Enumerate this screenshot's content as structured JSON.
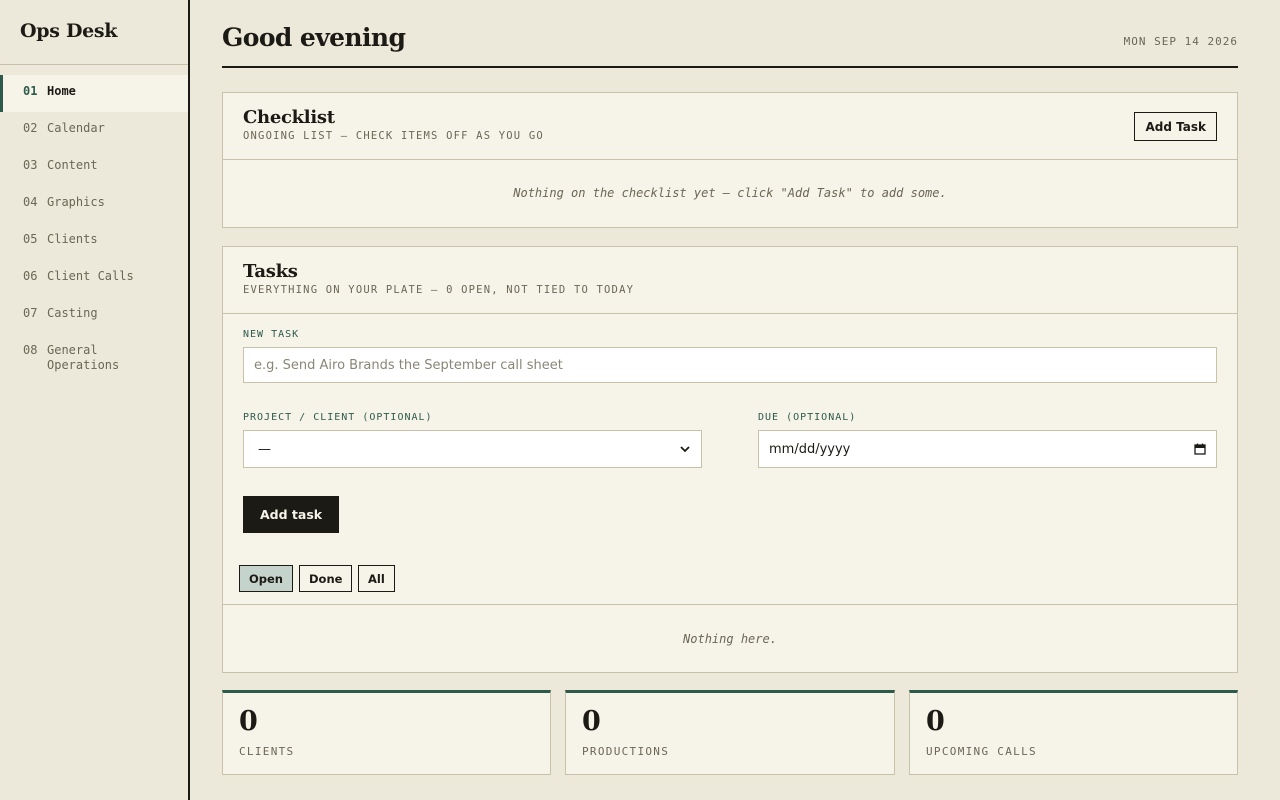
{
  "app": {
    "brand": "Ops Desk"
  },
  "sidebar": {
    "items": [
      {
        "num": "01",
        "label": "Home",
        "active": true
      },
      {
        "num": "02",
        "label": "Calendar"
      },
      {
        "num": "03",
        "label": "Content"
      },
      {
        "num": "04",
        "label": "Graphics"
      },
      {
        "num": "05",
        "label": "Clients"
      },
      {
        "num": "06",
        "label": "Client Calls"
      },
      {
        "num": "07",
        "label": "Casting"
      },
      {
        "num": "08",
        "label": "General Operations"
      }
    ]
  },
  "header": {
    "greeting": "Good evening",
    "date": "MON SEP 14 2026"
  },
  "checklist": {
    "title": "Checklist",
    "subtitle": "ONGOING LIST — CHECK ITEMS OFF AS YOU GO",
    "add_button": "Add Task",
    "empty_text": "Nothing on the checklist yet — click \"Add Task\" to add some."
  },
  "tasks": {
    "title": "Tasks",
    "subtitle": "EVERYTHING ON YOUR PLATE — 0 OPEN, NOT TIED TO TODAY",
    "new_task_label": "NEW TASK",
    "new_task_placeholder": "e.g. Send Airo Brands the September call sheet",
    "project_label": "PROJECT / CLIENT (OPTIONAL)",
    "project_value": "—",
    "due_label": "DUE (OPTIONAL)",
    "due_value": "mm/dd/yyyy",
    "add_button": "Add task",
    "filters": [
      {
        "label": "Open",
        "active": true
      },
      {
        "label": "Done"
      },
      {
        "label": "All"
      }
    ],
    "empty_text": "Nothing here."
  },
  "stats": [
    {
      "value": "0",
      "label": "CLIENTS"
    },
    {
      "value": "0",
      "label": "PRODUCTIONS"
    },
    {
      "value": "0",
      "label": "UPCOMING CALLS"
    }
  ],
  "colors": {
    "accent": "#2e5a4c",
    "background": "#ede9da",
    "panel": "#f6f3e8",
    "ink": "#1c1a14",
    "active_filter": "#c4d3cb"
  }
}
